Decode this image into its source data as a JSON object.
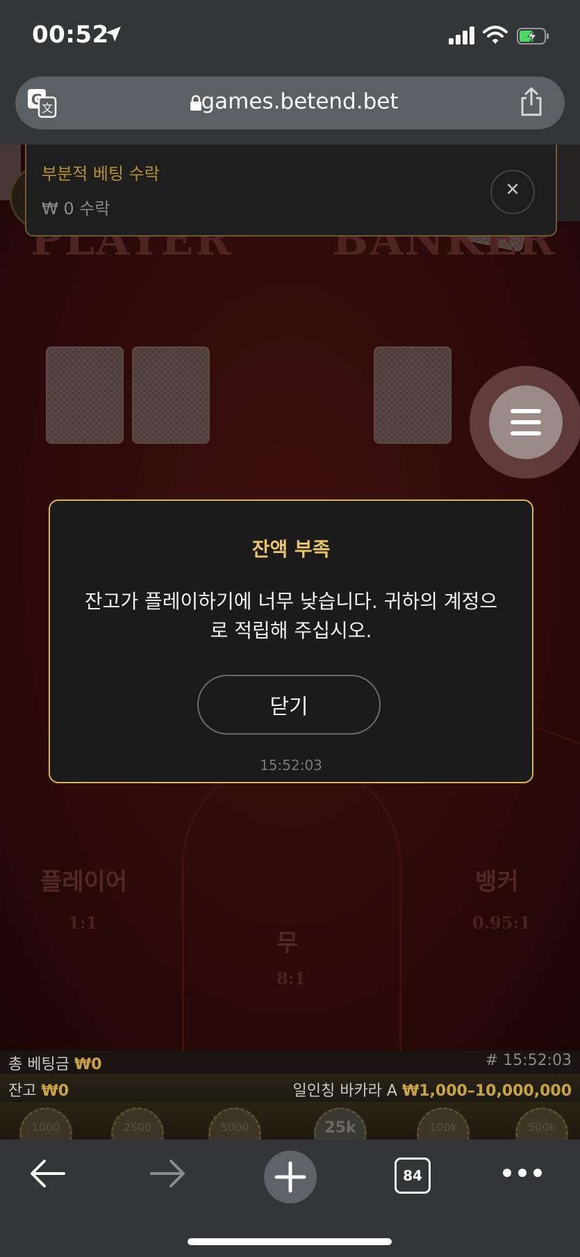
{
  "status": {
    "time": "00:52"
  },
  "browser": {
    "url": "games.betend.bet",
    "tabs_count": "84"
  },
  "notification": {
    "title": "부분적 베팅 수락",
    "subtitle": "₩ 0 수락"
  },
  "table": {
    "player_title": "PLAYER",
    "banker_title": "BANKER",
    "player_label": "플레이어",
    "player_odds": "1:1",
    "banker_label": "뱅커",
    "banker_odds": "0.95:1",
    "tie_label": "무",
    "tie_odds": "8:1"
  },
  "modal": {
    "title": "잔액 부족",
    "message_line1": "잔고가 플레이하기에 너무 낮습니다. 귀하의 계정으",
    "message_line2": "로 적립해 주십시오.",
    "close_label": "닫기",
    "timestamp": "15:52:03"
  },
  "footer": {
    "total_bet_label": "총 베팅금",
    "total_bet_value": "₩0",
    "round_id": "# 15:52:03",
    "balance_label": "잔고",
    "balance_value": "₩0",
    "table_name": "일인칭 바카라 A",
    "bet_limits": "₩1,000–10,000,000"
  },
  "chips": [
    "1000",
    "2500",
    "5000",
    "25k",
    "100k",
    "500k"
  ]
}
